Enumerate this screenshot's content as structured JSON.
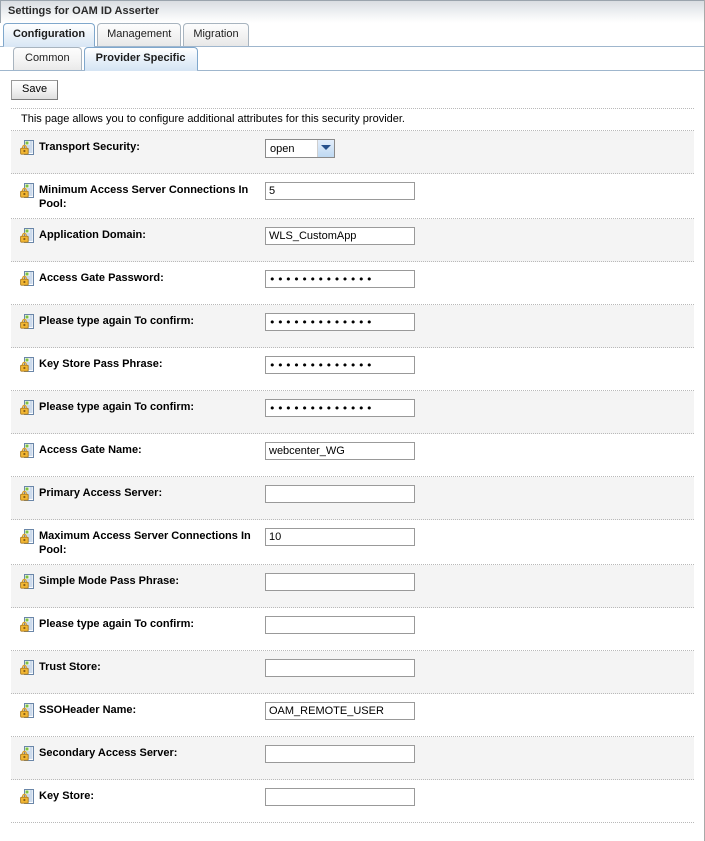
{
  "window": {
    "title": "Settings for OAM ID Asserter"
  },
  "tabs_outer": [
    {
      "label": "Configuration",
      "active": true
    },
    {
      "label": "Management",
      "active": false
    },
    {
      "label": "Migration",
      "active": false
    }
  ],
  "tabs_inner": [
    {
      "label": "Common",
      "active": false
    },
    {
      "label": "Provider Specific",
      "active": true
    }
  ],
  "toolbar": {
    "save_label": "Save"
  },
  "info": {
    "text": "This page allows you to configure additional attributes for this security provider."
  },
  "icons": {
    "attribute_lock": "lock-document-icon",
    "dropdown": "chevron-down-icon"
  },
  "form": {
    "rows": [
      {
        "label": "Transport Security:",
        "control": "select",
        "value": "open",
        "name": "transport-security"
      },
      {
        "label": "Minimum Access Server Connections In Pool:",
        "control": "text",
        "value": "5",
        "name": "minimum-access-server-connections-in-pool"
      },
      {
        "label": "Application Domain:",
        "control": "text",
        "value": "WLS_CustomApp",
        "name": "application-domain"
      },
      {
        "label": "Access Gate Password:",
        "control": "password",
        "value": "•••••••••••••",
        "name": "access-gate-password"
      },
      {
        "label": "Please type again To confirm:",
        "control": "password",
        "value": "•••••••••••••",
        "name": "access-gate-password-confirm"
      },
      {
        "label": "Key Store Pass Phrase:",
        "control": "password",
        "value": "•••••••••••••",
        "name": "key-store-pass-phrase"
      },
      {
        "label": "Please type again To confirm:",
        "control": "password",
        "value": "•••••••••••••",
        "name": "key-store-pass-phrase-confirm"
      },
      {
        "label": "Access Gate Name:",
        "control": "text",
        "value": "webcenter_WG",
        "name": "access-gate-name"
      },
      {
        "label": "Primary Access Server:",
        "control": "text",
        "value": "",
        "name": "primary-access-server"
      },
      {
        "label": "Maximum Access Server Connections In Pool:",
        "control": "text",
        "value": "10",
        "name": "maximum-access-server-connections-in-pool"
      },
      {
        "label": "Simple Mode Pass Phrase:",
        "control": "text",
        "value": "",
        "name": "simple-mode-pass-phrase"
      },
      {
        "label": "Please type again To confirm:",
        "control": "text",
        "value": "",
        "name": "simple-mode-pass-phrase-confirm"
      },
      {
        "label": "Trust Store:",
        "control": "text",
        "value": "",
        "name": "trust-store"
      },
      {
        "label": "SSOHeader Name:",
        "control": "text",
        "value": "OAM_REMOTE_USER",
        "name": "ssoheader-name"
      },
      {
        "label": "Secondary Access Server:",
        "control": "text",
        "value": "",
        "name": "secondary-access-server"
      },
      {
        "label": "Key Store:",
        "control": "text",
        "value": "",
        "name": "key-store"
      }
    ]
  },
  "colors": {
    "active_tab": "#d9e7f5",
    "row_shaded": "#f4f4f4",
    "row_plain": "#ffffff",
    "border": "#9aa4ad",
    "dropdown_button": "#bfd9f2"
  }
}
